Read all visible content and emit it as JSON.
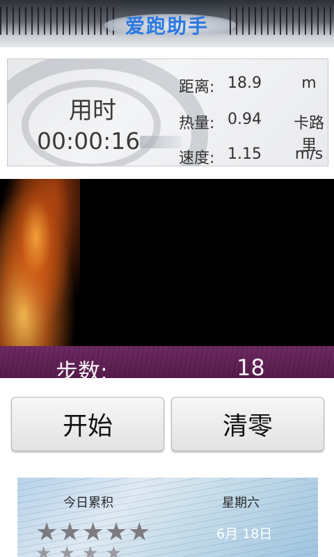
{
  "app": {
    "title": "爱跑助手"
  },
  "stats": {
    "time_label": "用时",
    "time_value": "00:00:16",
    "distance": {
      "label": "距离:",
      "value": "18.9",
      "unit": "m"
    },
    "calories": {
      "label": "热量:",
      "value": "0.94",
      "unit": "卡路里"
    },
    "speed": {
      "label": "速度:",
      "value": "1.15",
      "unit": "m/s"
    }
  },
  "steps": {
    "label": "步数:",
    "value": "18"
  },
  "buttons": {
    "start": "开始",
    "reset": "清零"
  },
  "summary": {
    "today_label": "今日累积",
    "weekday": "星期六",
    "date": "6月 18日",
    "stars_row1": "★★★★★",
    "stars_row2": "★ ★ ★ ★"
  },
  "colors": {
    "title_blue": "#2a78e0",
    "steps_bar": "#6e2a63",
    "flame_bg": "#000000"
  }
}
